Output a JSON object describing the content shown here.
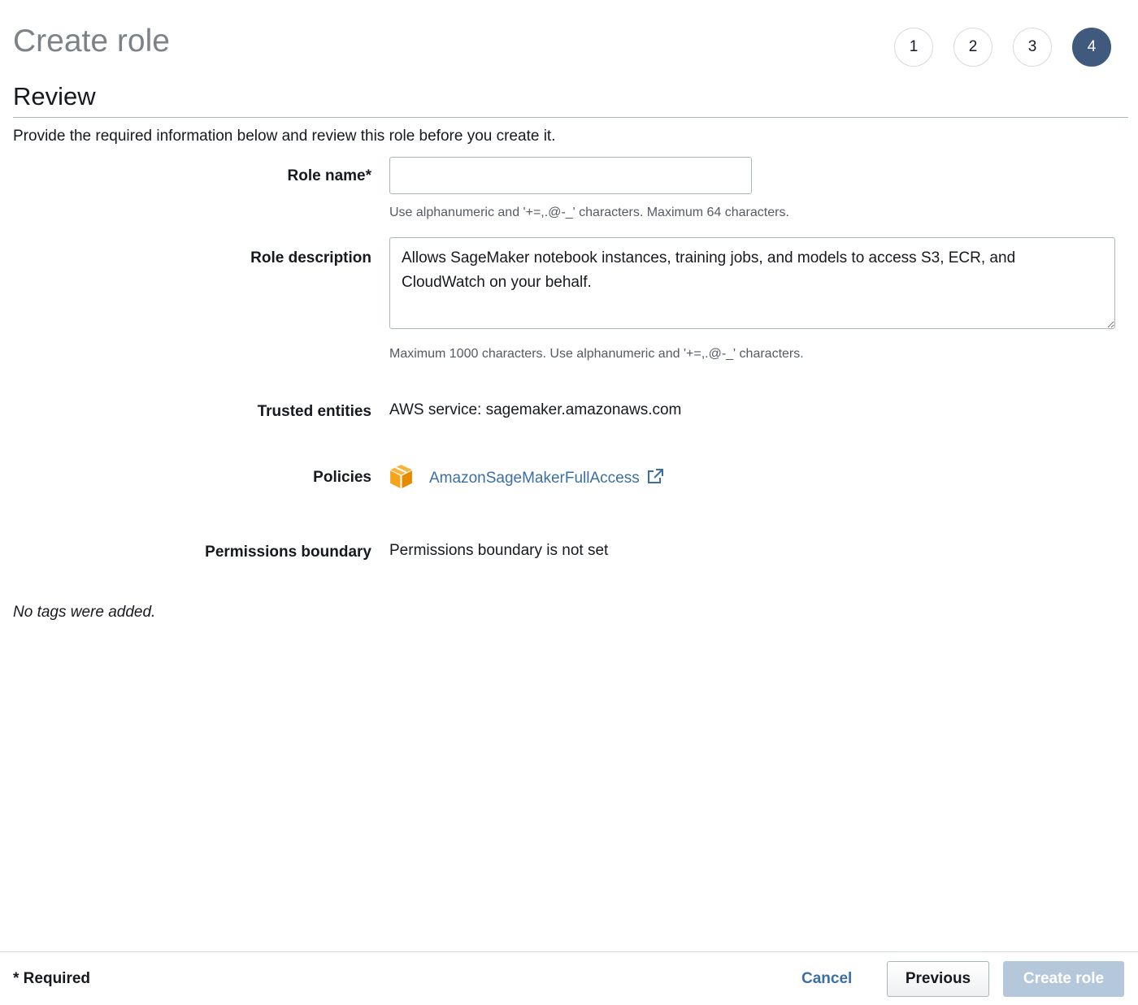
{
  "header": {
    "title": "Create role",
    "steps": [
      "1",
      "2",
      "3",
      "4"
    ],
    "active_step": "4"
  },
  "review": {
    "title": "Review",
    "intro": "Provide the required information below and review this role before you create it."
  },
  "form": {
    "role_name": {
      "label": "Role name*",
      "value": "",
      "hint": "Use alphanumeric and '+=,.@-_' characters. Maximum 64 characters."
    },
    "role_description": {
      "label": "Role description",
      "value": "Allows SageMaker notebook instances, training jobs, and models to access S3, ECR, and CloudWatch on your behalf.",
      "hint": "Maximum 1000 characters. Use alphanumeric and '+=,.@-_' characters."
    },
    "trusted_entities": {
      "label": "Trusted entities",
      "value": "AWS service: sagemaker.amazonaws.com"
    },
    "policies": {
      "label": "Policies",
      "items": [
        {
          "name": "AmazonSageMakerFullAccess",
          "icon": "policy-cube-icon"
        }
      ]
    },
    "permissions_boundary": {
      "label": "Permissions boundary",
      "value": "Permissions boundary is not set"
    }
  },
  "tags_note": "No tags were added.",
  "footer": {
    "required_note": "* Required",
    "cancel_label": "Cancel",
    "previous_label": "Previous",
    "create_label": "Create role"
  },
  "colors": {
    "active_step": "#3f5a7d",
    "link": "#3b6fa3",
    "policy_icon": "#f7a41d",
    "create_disabled": "#b5c7db"
  }
}
